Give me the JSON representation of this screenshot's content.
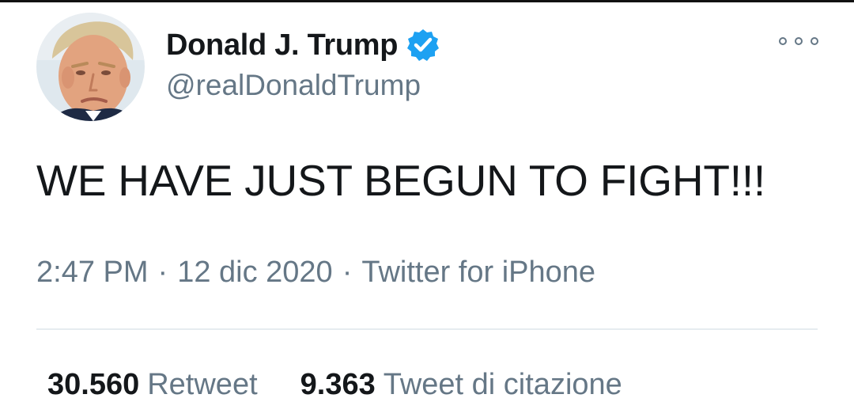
{
  "user": {
    "display_name": "Donald J. Trump",
    "handle": "@realDonaldTrump",
    "verified": true,
    "verified_color": "#1da1f2"
  },
  "tweet": {
    "text": "WE HAVE JUST BEGUN TO FIGHT!!!",
    "time": "2:47 PM",
    "date": "12 dic 2020",
    "source": "Twitter for iPhone",
    "separator": "·"
  },
  "stats": {
    "retweets_count": "30.560",
    "retweets_label": "Retweet",
    "quotes_count": "9.363",
    "quotes_label": "Tweet di citazione"
  },
  "icons": {
    "more": "more-options-icon",
    "verified": "verified-badge-icon"
  },
  "colors": {
    "text": "#14171a",
    "secondary": "#657786",
    "divider": "#e6ecf0"
  }
}
